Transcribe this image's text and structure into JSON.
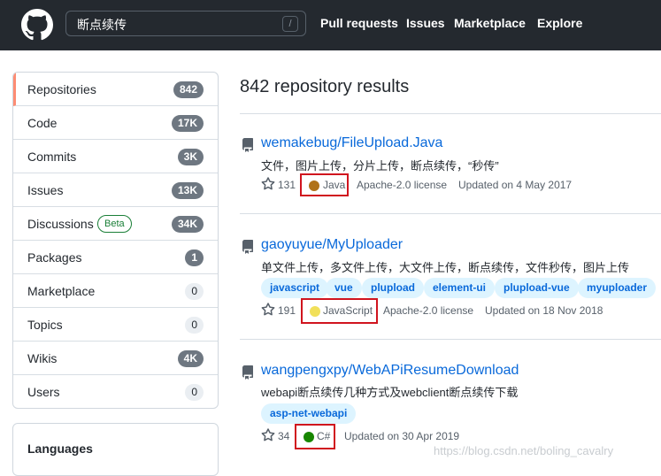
{
  "header": {
    "search_value": "断点续传",
    "search_shortcut": "/",
    "nav": [
      "Pull requests",
      "Issues",
      "Marketplace",
      "Explore"
    ]
  },
  "sidebar": {
    "items": [
      {
        "label": "Repositories",
        "count": "842"
      },
      {
        "label": "Code",
        "count": "17K"
      },
      {
        "label": "Commits",
        "count": "3K"
      },
      {
        "label": "Issues",
        "count": "13K"
      },
      {
        "label": "Discussions",
        "count": "34K",
        "badge": "Beta"
      },
      {
        "label": "Packages",
        "count": "1"
      },
      {
        "label": "Marketplace",
        "count": "0"
      },
      {
        "label": "Topics",
        "count": "0"
      },
      {
        "label": "Wikis",
        "count": "4K"
      },
      {
        "label": "Users",
        "count": "0"
      }
    ],
    "languages_title": "Languages"
  },
  "main": {
    "results_title": "842 repository results",
    "repos": [
      {
        "name": "wemakebug/FileUpload.Java",
        "description": "文件，图片上传，分片上传，断点续传，“秒传”",
        "stars": "131",
        "language": "Java",
        "language_color": "#b07219",
        "license": "Apache-2.0 license",
        "updated": "Updated on 4 May 2017",
        "topics": []
      },
      {
        "name": "gaoyuyue/MyUploader",
        "description": "单文件上传，多文件上传，大文件上传，断点续传，文件秒传，图片上传",
        "stars": "191",
        "language": "JavaScript",
        "language_color": "#f1e05a",
        "license": "Apache-2.0 license",
        "updated": "Updated on 18 Nov 2018",
        "topics": [
          "javascript",
          "vue",
          "plupload",
          "element-ui",
          "plupload-vue",
          "myuploader"
        ]
      },
      {
        "name": "wangpengxpy/WebAPiResumeDownload",
        "description": "webapi断点续传几种方式及webclient断点续传下载",
        "stars": "34",
        "language": "C#",
        "language_color": "#178600",
        "license": "",
        "updated": "Updated on 30 Apr 2019",
        "topics": [
          "asp-net-webapi"
        ]
      }
    ]
  },
  "watermark": "https://blog.csdn.net/boling_cavalry"
}
